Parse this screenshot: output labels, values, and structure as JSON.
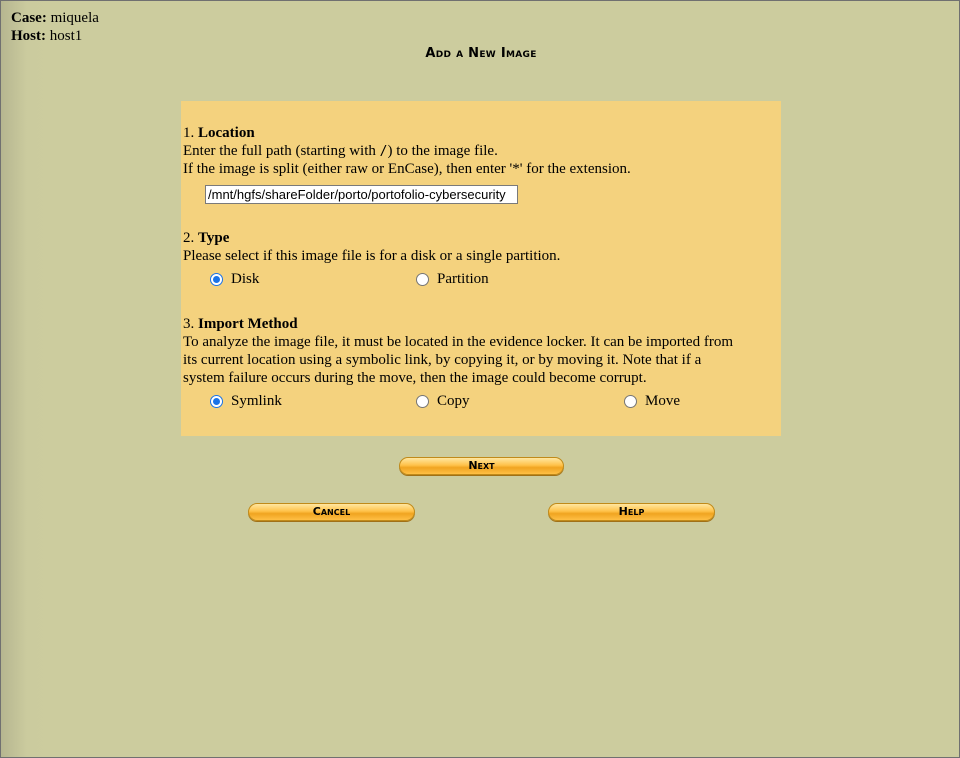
{
  "case": {
    "label": "Case:",
    "value": "miquela"
  },
  "host": {
    "label": "Host:",
    "value": "host1"
  },
  "page_title": "Add a New Image",
  "location": {
    "number": "1.",
    "heading": "Location",
    "desc_line1_pre": "Enter the full path (starting with ",
    "desc_line1_code": "/",
    "desc_line1_post": ") to the image file.",
    "desc_line2": "If the image is split (either raw or EnCase), then enter '*' for the extension.",
    "path_value": "/mnt/hgfs/shareFolder/porto/portofolio-cybersecurity"
  },
  "type": {
    "number": "2.",
    "heading": "Type",
    "desc": "Please select if this image file is for a disk or a single partition.",
    "options": [
      "Disk",
      "Partition"
    ],
    "selected": "Disk"
  },
  "import_method": {
    "number": "3.",
    "heading": "Import Method",
    "desc_line1": "To analyze the image file, it must be located in the evidence locker. It can be imported from",
    "desc_line2": "its current location using a symbolic link, by copying it, or by moving it. Note that if a",
    "desc_line3": "system failure occurs during the move, then the image could become corrupt.",
    "options": [
      "Symlink",
      "Copy",
      "Move"
    ],
    "selected": "Symlink"
  },
  "buttons": {
    "next": "Next",
    "cancel": "Cancel",
    "help": "Help"
  },
  "colors": {
    "background": "#cccc9e",
    "panel": "#f4d27e",
    "button": "#ffc24a",
    "radio_selected": "#1a73e8"
  }
}
